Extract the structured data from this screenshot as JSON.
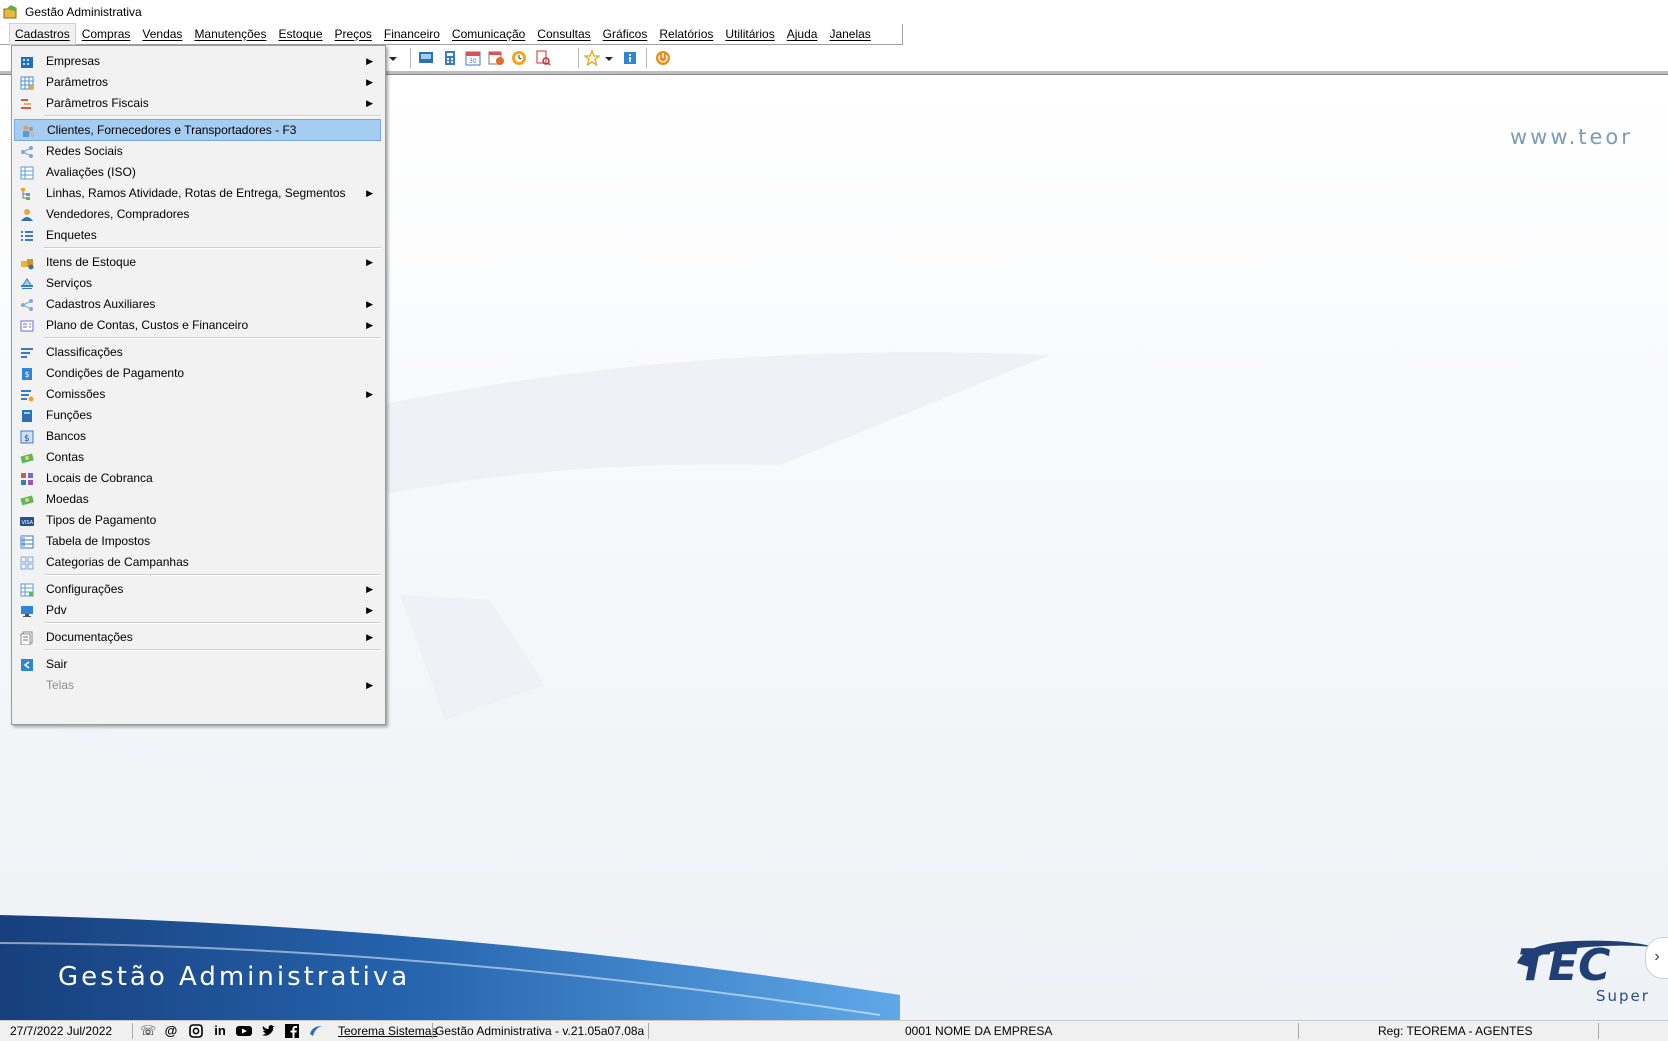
{
  "window": {
    "title": "Gestão Administrativa"
  },
  "menubar": [
    "Cadastros",
    "Compras",
    "Vendas",
    "Manutenções",
    "Estoque",
    "Preços",
    "Financeiro",
    "Comunicação",
    "Consultas",
    "Gráficos",
    "Relatórios",
    "Utilitários",
    "Ajuda",
    "Janelas"
  ],
  "dropdown": {
    "items": [
      {
        "label": "Empresas",
        "submenu": true,
        "icon": "building-icon"
      },
      {
        "label": "Parâmetros",
        "submenu": true,
        "icon": "grid-settings-icon"
      },
      {
        "label": "Parâmetros Fiscais",
        "submenu": true,
        "icon": "fiscal-bars-icon"
      },
      {
        "label": "Clientes, Fornecedores e Transportadores - F3",
        "submenu": false,
        "icon": "people-icon",
        "highlighted": true
      },
      {
        "label": "Redes Sociais",
        "submenu": false,
        "icon": "network-icon"
      },
      {
        "label": "Avaliações (ISO)",
        "submenu": false,
        "icon": "table-icon"
      },
      {
        "label": "Linhas, Ramos Atividade, Rotas de Entrega, Segmentos",
        "submenu": true,
        "icon": "tree-icon"
      },
      {
        "label": "Vendedores, Compradores",
        "submenu": false,
        "icon": "person-icon"
      },
      {
        "label": "Enquetes",
        "submenu": false,
        "icon": "list-icon"
      },
      {
        "label": "Itens de Estoque",
        "submenu": true,
        "icon": "boxes-icon"
      },
      {
        "label": "Serviços",
        "submenu": false,
        "icon": "service-icon"
      },
      {
        "label": "Cadastros Auxiliares",
        "submenu": true,
        "icon": "network-icon"
      },
      {
        "label": "Plano de Contas, Custos e Financeiro",
        "submenu": true,
        "icon": "accounts-icon"
      },
      {
        "label": "Classificações",
        "submenu": false,
        "icon": "sort-icon"
      },
      {
        "label": "Condições de Pagamento",
        "submenu": false,
        "icon": "payment-doc-icon"
      },
      {
        "label": "Comissões",
        "submenu": true,
        "icon": "commission-icon"
      },
      {
        "label": "Funções",
        "submenu": false,
        "icon": "book-icon"
      },
      {
        "label": "Bancos",
        "submenu": false,
        "icon": "bank-icon"
      },
      {
        "label": "Contas",
        "submenu": false,
        "icon": "money-icon"
      },
      {
        "label": "Locais de Cobranca",
        "submenu": false,
        "icon": "tiles-icon"
      },
      {
        "label": "Moedas",
        "submenu": false,
        "icon": "money-icon"
      },
      {
        "label": "Tipos de Pagamento",
        "submenu": false,
        "icon": "card-icon"
      },
      {
        "label": "Tabela de Impostos",
        "submenu": false,
        "icon": "tax-table-icon"
      },
      {
        "label": "Categorias de Campanhas",
        "submenu": false,
        "icon": "categories-icon"
      },
      {
        "label": "Configurações",
        "submenu": true,
        "icon": "config-grid-icon"
      },
      {
        "label": "Pdv",
        "submenu": true,
        "icon": "monitor-icon"
      },
      {
        "label": "Documentações",
        "submenu": true,
        "icon": "document-icon"
      },
      {
        "label": "Sair",
        "submenu": false,
        "icon": "exit-icon"
      },
      {
        "label": "Telas",
        "submenu": true,
        "icon": "",
        "disabled": true
      }
    ]
  },
  "background": {
    "url_text": "www.teor",
    "banner_title": "Gestão Administrativa",
    "logo_text": "TEC",
    "logo_sub": "Super"
  },
  "status": {
    "date": "27/7/2022 Jul/2022",
    "company_link": "Teorema Sistemas",
    "version": "Gestão Administrativa - v.21.05a07.08a",
    "company_name": "0001 NOME DA EMPRESA",
    "registration": "Reg: TEOREMA - AGENTES"
  },
  "colors": {
    "menu_highlight": "#a5cdf2",
    "banner_blue": "#1e4f8f",
    "logo_blue": "#1f3f75"
  }
}
